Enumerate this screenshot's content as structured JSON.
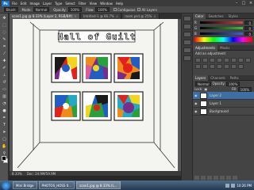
{
  "menubar": {
    "logo": "Ps",
    "items": [
      "File",
      "Edit",
      "Image",
      "Layer",
      "Type",
      "Select",
      "Filter",
      "View",
      "Window",
      "Help"
    ],
    "window_controls": [
      "–",
      "□",
      "×"
    ]
  },
  "options_bar": {
    "tool_label": "Brush",
    "mode_label": "Mode:",
    "mode_value": "Normal",
    "opacity_label": "Opacity:",
    "opacity_value": "100%",
    "flow_label": "Flow:",
    "flow_value": "100%",
    "contiguous_label": "Contiguous",
    "all_layers_label": "All Layers"
  },
  "document_tabs": [
    {
      "label": "scan1.jpg @ 8.33% (Layer 2, RGB/8#)",
      "active": true
    },
    {
      "label": "Untitled-1 @ 66.7%",
      "active": false
    },
    {
      "label": "room.psd @ 25%",
      "active": false
    }
  ],
  "artwork": {
    "banner_text": "Hall of Guilt",
    "colors": {
      "paint_red": "#e32019",
      "paint_orange": "#f08a1b",
      "paint_yellow": "#f2d51c",
      "paint_blue": "#1f5fc4",
      "paint_green": "#2aa03d",
      "paint_cyan": "#23a9c6",
      "paint_purple": "#7a2c8c",
      "paint_pink": "#e05a9a",
      "ink": "#1a1a1a"
    }
  },
  "status_bar": {
    "zoom": "8.33%",
    "doc_info": "Doc: 24.9M/59.9M"
  },
  "color_panel": {
    "tabs": [
      "Color",
      "Swatches",
      "Styles"
    ],
    "rows": [
      {
        "label": "R",
        "value": "0",
        "color": "#e04040"
      },
      {
        "label": "G",
        "value": "0",
        "color": "#40c040"
      },
      {
        "label": "B",
        "value": "0",
        "color": "#4060e0"
      }
    ]
  },
  "adjustments_panel": {
    "tabs": [
      "Adjustments",
      "Masks"
    ],
    "subtitle": "Add an adjustment"
  },
  "layers_panel": {
    "tabs": [
      "Layers",
      "Channels",
      "Paths"
    ],
    "blend_mode": "Normal",
    "opacity_label": "Opacity:",
    "opacity_value": "100%",
    "lock_label": "Lock:",
    "fill_label": "Fill:",
    "fill_value": "100%",
    "layers": [
      {
        "name": "Layer 2",
        "selected": true
      },
      {
        "name": "Layer 1",
        "selected": false
      },
      {
        "name": "Background",
        "selected": false
      }
    ]
  },
  "taskbar": {
    "tasks": [
      {
        "label": "Mini Bridge",
        "active": false
      },
      {
        "label": "PHOTOS_HOSS 0...",
        "active": false
      },
      {
        "label": "scan1.jpg @ 8.33% (L...",
        "active": true
      }
    ],
    "time": "10:26 PM"
  }
}
